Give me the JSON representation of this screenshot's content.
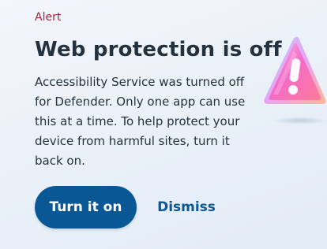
{
  "alert": {
    "eyebrow": "Alert",
    "title": "Web protection is off",
    "message": "Accessibility Service was turned off for Defender. Only one app can use this at a time. To help protect your device from harmful sites, turn it back on.",
    "primary_label": "Turn it on",
    "secondary_label": "Dismiss",
    "illustration_icon": "warning-triangle-icon"
  },
  "colors": {
    "eyebrow": "#a1253c",
    "primary_button": "#0a5795",
    "text": "#24323f",
    "link": "#0a5795"
  }
}
